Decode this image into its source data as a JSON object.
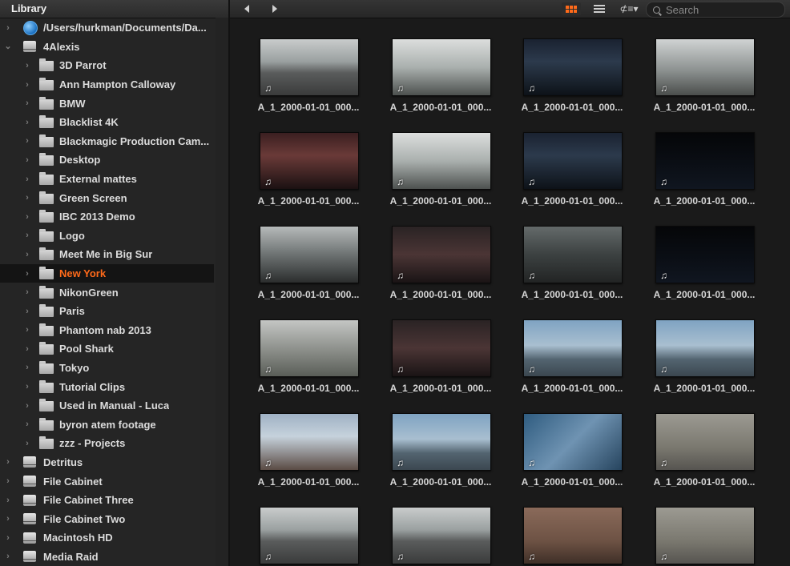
{
  "sidebar": {
    "title": "Library",
    "items": [
      {
        "label": "/Users/hurkman/Documents/Da...",
        "level": 0,
        "icon": "network-icon",
        "chevron": "›",
        "selected": false
      },
      {
        "label": "4Alexis",
        "level": 0,
        "icon": "drive-icon",
        "chevron": "⌄",
        "selected": false
      },
      {
        "label": "3D Parrot",
        "level": 1,
        "icon": "folder-icon",
        "chevron": "›",
        "selected": false
      },
      {
        "label": "Ann Hampton Calloway",
        "level": 1,
        "icon": "folder-icon",
        "chevron": "›",
        "selected": false
      },
      {
        "label": "BMW",
        "level": 1,
        "icon": "folder-icon",
        "chevron": "›",
        "selected": false
      },
      {
        "label": "Blacklist 4K",
        "level": 1,
        "icon": "folder-icon",
        "chevron": "›",
        "selected": false
      },
      {
        "label": "Blackmagic Production Cam...",
        "level": 1,
        "icon": "folder-icon",
        "chevron": "›",
        "selected": false
      },
      {
        "label": "Desktop",
        "level": 1,
        "icon": "folder-icon",
        "chevron": "›",
        "selected": false
      },
      {
        "label": "External mattes",
        "level": 1,
        "icon": "folder-icon",
        "chevron": "›",
        "selected": false
      },
      {
        "label": "Green Screen",
        "level": 1,
        "icon": "folder-icon",
        "chevron": "›",
        "selected": false
      },
      {
        "label": "IBC 2013 Demo",
        "level": 1,
        "icon": "folder-icon",
        "chevron": "›",
        "selected": false
      },
      {
        "label": "Logo",
        "level": 1,
        "icon": "folder-icon",
        "chevron": "›",
        "selected": false
      },
      {
        "label": "Meet Me in Big Sur",
        "level": 1,
        "icon": "folder-icon",
        "chevron": "›",
        "selected": false
      },
      {
        "label": "New York",
        "level": 1,
        "icon": "folder-icon",
        "chevron": "›",
        "selected": true
      },
      {
        "label": "NikonGreen",
        "level": 1,
        "icon": "folder-icon",
        "chevron": "›",
        "selected": false
      },
      {
        "label": "Paris",
        "level": 1,
        "icon": "folder-icon",
        "chevron": "›",
        "selected": false
      },
      {
        "label": "Phantom nab 2013",
        "level": 1,
        "icon": "folder-icon",
        "chevron": "›",
        "selected": false
      },
      {
        "label": "Pool Shark",
        "level": 1,
        "icon": "folder-icon",
        "chevron": "›",
        "selected": false
      },
      {
        "label": "Tokyo",
        "level": 1,
        "icon": "folder-icon",
        "chevron": "›",
        "selected": false
      },
      {
        "label": "Tutorial Clips",
        "level": 1,
        "icon": "folder-icon",
        "chevron": "›",
        "selected": false
      },
      {
        "label": "Used in Manual - Luca",
        "level": 1,
        "icon": "folder-icon",
        "chevron": "›",
        "selected": false
      },
      {
        "label": "byron atem footage",
        "level": 1,
        "icon": "folder-icon",
        "chevron": "›",
        "selected": false
      },
      {
        "label": "zzz - Projects",
        "level": 1,
        "icon": "folder-icon",
        "chevron": "›",
        "selected": false
      },
      {
        "label": "Detritus",
        "level": 0,
        "icon": "drive-icon",
        "chevron": "›",
        "selected": false
      },
      {
        "label": "File Cabinet",
        "level": 0,
        "icon": "drive-icon",
        "chevron": "›",
        "selected": false
      },
      {
        "label": "File Cabinet Three",
        "level": 0,
        "icon": "drive-icon",
        "chevron": "›",
        "selected": false
      },
      {
        "label": "File Cabinet Two",
        "level": 0,
        "icon": "drive-icon",
        "chevron": "›",
        "selected": false
      },
      {
        "label": "Macintosh HD",
        "level": 0,
        "icon": "drive-icon",
        "chevron": "›",
        "selected": false
      },
      {
        "label": "Media Raid",
        "level": 0,
        "icon": "drive-icon",
        "chevron": "›",
        "selected": false
      }
    ]
  },
  "toolbar": {
    "back_icon": "back-arrow-icon",
    "forward_icon": "forward-arrow-icon",
    "view_icons": [
      "thumbnail-view-icon",
      "list-view-icon",
      "sort-menu-icon"
    ],
    "sort_glyph": "⊄≡▾",
    "search_placeholder": "Search"
  },
  "colors": {
    "accent": "#ff6a1a",
    "selected_row_bg": "#141414",
    "text": "#dcdcdc"
  },
  "clips": [
    {
      "name": "A_1_2000-01-01_000...",
      "style": "street",
      "audio": "♫"
    },
    {
      "name": "A_1_2000-01-01_000...",
      "style": "trees",
      "audio": "♫"
    },
    {
      "name": "A_1_2000-01-01_000...",
      "style": "night",
      "audio": "♫"
    },
    {
      "name": "A_1_2000-01-01_000...",
      "style": "park",
      "audio": "♫"
    },
    {
      "name": "A_1_2000-01-01_000...",
      "style": "neon",
      "audio": "♫"
    },
    {
      "name": "A_1_2000-01-01_000...",
      "style": "trees",
      "audio": "♫"
    },
    {
      "name": "A_1_2000-01-01_000...",
      "style": "night",
      "audio": "♫"
    },
    {
      "name": "A_1_2000-01-01_000...",
      "style": "dark",
      "audio": "♫"
    },
    {
      "name": "A_1_2000-01-01_000...",
      "style": "skyscr",
      "audio": "♫"
    },
    {
      "name": "A_1_2000-01-01_000...",
      "style": "crowd",
      "audio": "♫"
    },
    {
      "name": "A_1_2000-01-01_000...",
      "style": "aerial",
      "audio": "♫"
    },
    {
      "name": "A_1_2000-01-01_000...",
      "style": "dark",
      "audio": "♫"
    },
    {
      "name": "A_1_2000-01-01_000...",
      "style": "bare",
      "audio": "♫"
    },
    {
      "name": "A_1_2000-01-01_000...",
      "style": "crowd",
      "audio": "♫"
    },
    {
      "name": "A_1_2000-01-01_000...",
      "style": "skyline",
      "audio": "♫"
    },
    {
      "name": "A_1_2000-01-01_000...",
      "style": "skyline",
      "audio": "♫"
    },
    {
      "name": "A_1_2000-01-01_000...",
      "style": "sign",
      "audio": "♫"
    },
    {
      "name": "A_1_2000-01-01_000...",
      "style": "skyline",
      "audio": "♫"
    },
    {
      "name": "A_1_2000-01-01_000...",
      "style": "glass",
      "audio": "♫"
    },
    {
      "name": "A_1_2000-01-01_000...",
      "style": "sidewalk",
      "audio": "♫"
    },
    {
      "name": "",
      "style": "street",
      "audio": "♫"
    },
    {
      "name": "",
      "style": "street",
      "audio": "♫"
    },
    {
      "name": "",
      "style": "brick",
      "audio": "♫"
    },
    {
      "name": "",
      "style": "sidewalk",
      "audio": "♫"
    }
  ]
}
